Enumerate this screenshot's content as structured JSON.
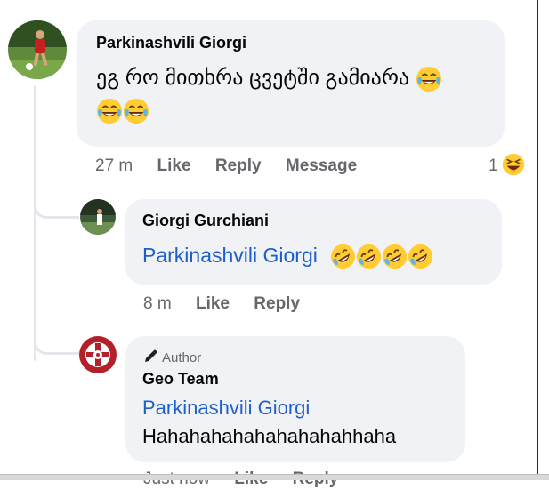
{
  "comments": [
    {
      "author": "Parkinashvili Giorgi",
      "text": "ეგ რო მითხრა ცვეტში გამიარა",
      "time": "27 m",
      "actions": [
        "Like",
        "Reply",
        "Message"
      ],
      "reaction_count": "1"
    },
    {
      "author": "Giorgi Gurchiani",
      "mention": "Parkinashvili Giorgi",
      "time": "8 m",
      "actions": [
        "Like",
        "Reply"
      ]
    },
    {
      "badge": "Author",
      "author": "Geo Team",
      "mention": "Parkinashvili Giorgi",
      "text": "Hahahahahahahahahahhaha",
      "time": "Just now",
      "actions": [
        "Like",
        "Reply"
      ]
    }
  ],
  "icons": {
    "laugh_cry": "face-with-tears-of-joy-icon",
    "rofl": "rolling-on-the-floor-laughing-icon",
    "squint_laugh": "grinning-squinting-face-icon",
    "author_badge": "pencil-icon"
  },
  "colors": {
    "bubble": "#f0f2f5",
    "mention": "#1b5fcf",
    "meta": "#65676b"
  }
}
